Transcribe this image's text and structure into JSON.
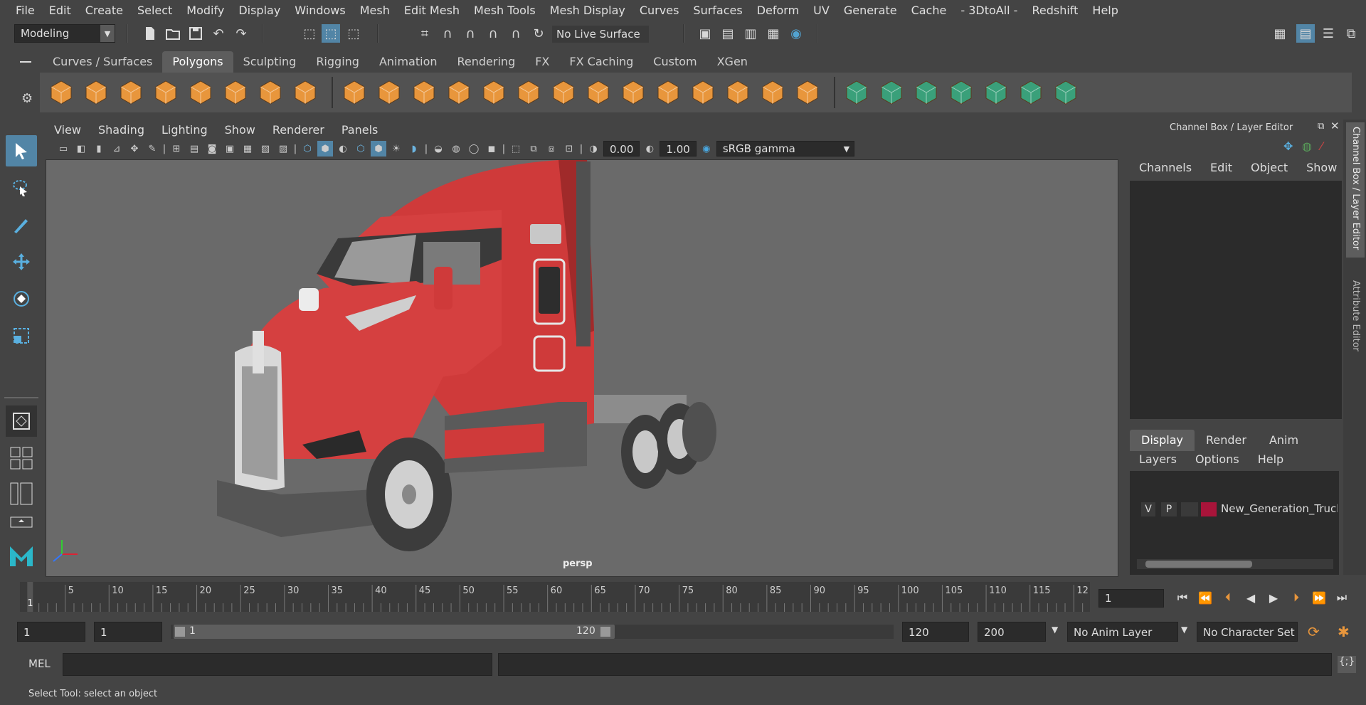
{
  "menubar": [
    "File",
    "Edit",
    "Create",
    "Select",
    "Modify",
    "Display",
    "Windows",
    "Mesh",
    "Edit Mesh",
    "Mesh Tools",
    "Mesh Display",
    "Curves",
    "Surfaces",
    "Deform",
    "UV",
    "Generate",
    "Cache",
    "- 3DtoAll -",
    "Redshift",
    "Help"
  ],
  "statusline": {
    "workspace": "Modeling",
    "live_surface": "No Live Surface"
  },
  "shelf_tabs": [
    "Curves / Surfaces",
    "Polygons",
    "Sculpting",
    "Rigging",
    "Animation",
    "Rendering",
    "FX",
    "FX Caching",
    "Custom",
    "XGen"
  ],
  "shelf_active": "Polygons",
  "viewport": {
    "menus": [
      "View",
      "Shading",
      "Lighting",
      "Show",
      "Renderer",
      "Panels"
    ],
    "exposure": "0.00",
    "gamma": "1.00",
    "color_space": "sRGB gamma",
    "camera_label": "persp"
  },
  "channel_box": {
    "title": "Channel Box / Layer Editor",
    "menus": [
      "Channels",
      "Edit",
      "Object",
      "Show"
    ]
  },
  "layer_editor": {
    "tabs": [
      "Display",
      "Render",
      "Anim"
    ],
    "menus": [
      "Layers",
      "Options",
      "Help"
    ],
    "layer": {
      "v": "V",
      "p": "P",
      "name": "New_Generation_Truck",
      "color": "#a8143a"
    }
  },
  "side_tabs": [
    "Channel Box / Layer Editor",
    "Attribute Editor"
  ],
  "timeline": {
    "ticks": [
      "5",
      "10",
      "15",
      "20",
      "25",
      "30",
      "35",
      "40",
      "45",
      "50",
      "55",
      "60",
      "65",
      "70",
      "75",
      "80",
      "85",
      "90",
      "95",
      "100",
      "105",
      "110",
      "115",
      "12"
    ],
    "start_marker": "1",
    "current_frame": "1"
  },
  "range": {
    "start": "1",
    "playback_start": "1",
    "slider_start": "1",
    "slider_end": "120",
    "playback_end": "120",
    "end": "200",
    "anim_layer": "No Anim Layer",
    "character_set": "No Character Set"
  },
  "command_line": {
    "label": "MEL"
  },
  "status_text": "Select Tool: select an object",
  "colors": {
    "accent": "#5285a6",
    "truck_red": "#d0393a",
    "shelf_orange": "#e8963c",
    "shelf_green": "#3aa07a"
  }
}
